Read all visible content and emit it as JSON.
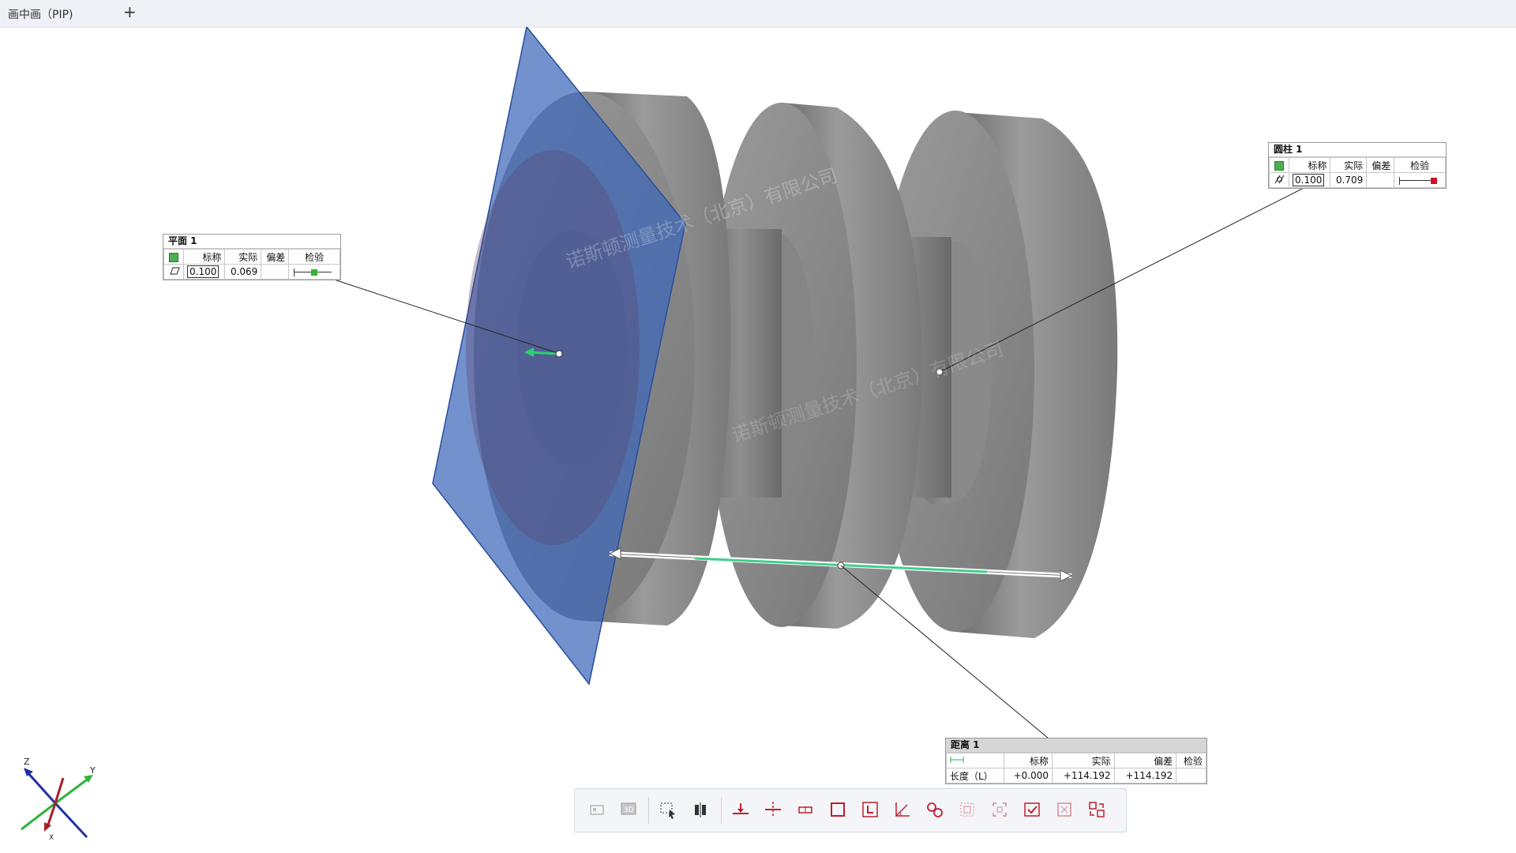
{
  "tab": {
    "title": "画中画（PIP)",
    "add": "+"
  },
  "watermark": "诺斯顿测量技术（北京）有限公司",
  "annotations": {
    "plane": {
      "title": "平面 1",
      "h_nominal": "标称",
      "h_actual": "实际",
      "h_dev": "偏差",
      "h_check": "检验",
      "nominal": "0.100",
      "actual": "0.069",
      "dev": "",
      "status_color": "#33b233",
      "status_level": 0.55
    },
    "cylinder": {
      "title": "圆柱 1",
      "h_nominal": "标称",
      "h_actual": "实际",
      "h_dev": "偏差",
      "h_check": "检验",
      "nominal": "0.100",
      "actual": "0.709",
      "dev": "",
      "status_color": "#d0102a",
      "status_level": 1.0
    },
    "distance": {
      "title": "距离 1",
      "h_nominal": "标称",
      "h_actual": "实际",
      "h_dev": "偏差",
      "h_check": "检验",
      "row_label": "长度（L）",
      "nominal": "+0.000",
      "actual": "+114.192",
      "dev": "+114.192",
      "check": ""
    }
  },
  "axes": {
    "x": "X",
    "y": "Y",
    "z": "Z"
  },
  "toolbar": {
    "buttons": [
      "view-2d-icon",
      "view-3d-icon",
      "box-select-icon",
      "align-icon",
      "plane-feature-icon",
      "section-icon",
      "distance-icon",
      "square-icon",
      "datum-icon",
      "angle-icon",
      "circles-icon",
      "fit-view-icon",
      "fit-selection-icon",
      "report-check-icon",
      "report-remove-icon",
      "export-icon"
    ]
  },
  "colors": {
    "plane": "#3d66b8",
    "part": "#8c8c8c",
    "accent_red": "#d0102a",
    "accent_green": "#33b233"
  }
}
